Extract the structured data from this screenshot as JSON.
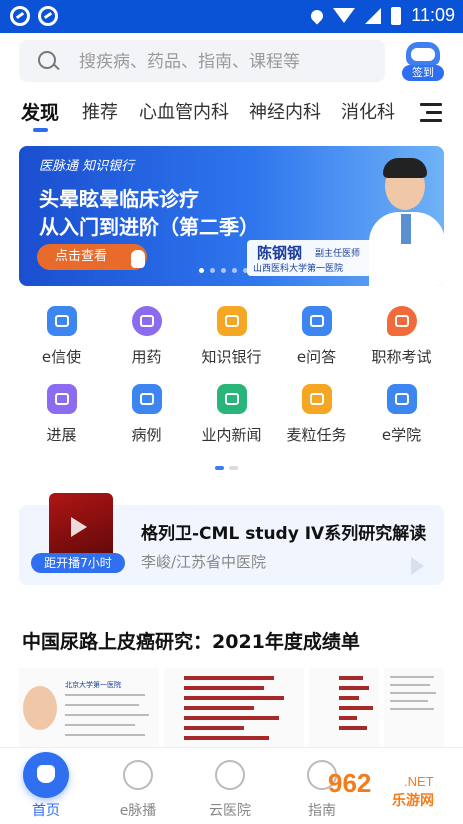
{
  "status_bar": {
    "time": "11:09"
  },
  "search": {
    "placeholder": "搜疾病、药品、指南、课程等",
    "signin_label": "签到"
  },
  "tabs": [
    {
      "label": "发现",
      "active": true
    },
    {
      "label": "推荐"
    },
    {
      "label": "心血管内科"
    },
    {
      "label": "神经内科"
    },
    {
      "label": "消化科"
    }
  ],
  "banner": {
    "brand": "医脉通  知识银行",
    "line1": "头晕眩晕临床诊疗",
    "line2": "从入门到进阶（第二季）",
    "button": "点击查看",
    "doctor_name": "陈钢钢",
    "doctor_title": "副主任医师",
    "hospital": "山西医科大学第一医院"
  },
  "quick_entries": [
    {
      "label": "e信使",
      "color": "#3d86f2"
    },
    {
      "label": "用药",
      "color": "#8b6cf0"
    },
    {
      "label": "知识银行",
      "color": "#f5a623"
    },
    {
      "label": "e问答",
      "color": "#3d86f2"
    },
    {
      "label": "职称考试",
      "color": "#f26a3a"
    },
    {
      "label": "进展",
      "color": "#8b6cf0"
    },
    {
      "label": "病例",
      "color": "#3d86f2"
    },
    {
      "label": "业内新闻",
      "color": "#27b57a"
    },
    {
      "label": "麦粒任务",
      "color": "#f5a623"
    },
    {
      "label": "e学院",
      "color": "#3d86f2"
    }
  ],
  "live": {
    "badge": "距开播7小时",
    "title": "格列卫-CML study IV系列研究解读",
    "subtitle": "李峻/江苏省中医院"
  },
  "article": {
    "title": "中国尿路上皮癌研究：2021年度成绩单",
    "thumb_header": "北京大学第一医院"
  },
  "bottom_nav": [
    {
      "label": "首页",
      "active": true
    },
    {
      "label": "e脉播"
    },
    {
      "label": "云医院"
    },
    {
      "label": "指南"
    }
  ],
  "watermark": {
    "number": "962",
    "domain": ".NET",
    "text": "乐游网"
  }
}
